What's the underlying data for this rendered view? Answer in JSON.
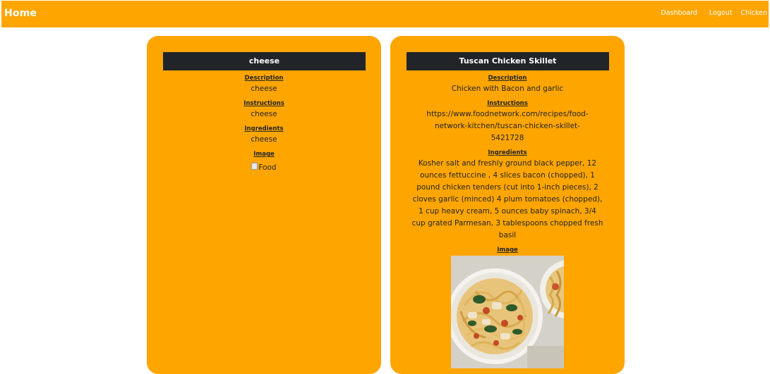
{
  "nav": {
    "brand": "Home",
    "links": [
      "Dashboard",
      "Logout",
      "Chicken"
    ]
  },
  "cards": [
    {
      "title": "cheese",
      "description_label": "Description",
      "description": "cheese",
      "instructions_label": "Instructions",
      "instructions": "cheese",
      "ingredients_label": "Ingredients",
      "ingredients": "cheese",
      "image_label": "Image",
      "image_alt": "Food"
    },
    {
      "title": "Tuscan Chicken Skillet",
      "description_label": "Description",
      "description": "Chicken with Bacon and garlic",
      "instructions_label": "Instructions",
      "instructions": "https://www.foodnetwork.com/recipes/food-network-kitchen/tuscan-chicken-skillet-5421728",
      "ingredients_label": "Ingredients",
      "ingredients": "Kosher salt and freshly ground black pepper, 12 ounces fettuccine , 4 slices bacon (chopped), 1 pound chicken tenders (cut into 1-inch pieces), 2 cloves garlic (minced) 4 plum tomatoes (chopped), 1 cup heavy cream, 5 ounces baby spinach, 3/4 cup grated Parmesan, 3 tablespoons chopped fresh basil",
      "image_label": "Image",
      "image_alt": "Food"
    }
  ]
}
